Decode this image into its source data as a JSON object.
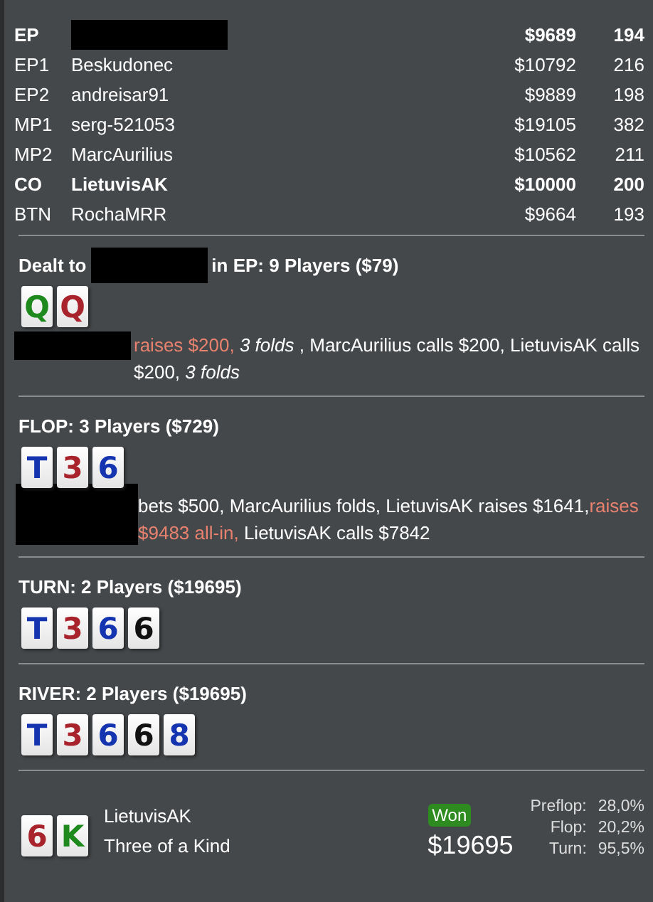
{
  "players": [
    {
      "position": "EP",
      "name_redacted": true,
      "stack": "$9689",
      "bb": "194",
      "hero": true
    },
    {
      "position": "EP1",
      "name_redacted": false,
      "name": "Beskudonec",
      "stack": "$10792",
      "bb": "216",
      "hero": false
    },
    {
      "position": "EP2",
      "name_redacted": false,
      "name": "andreisar91",
      "stack": "$9889",
      "bb": "198",
      "hero": false
    },
    {
      "position": "MP1",
      "name_redacted": false,
      "name": "serg-521053",
      "stack": "$19105",
      "bb": "382",
      "hero": false
    },
    {
      "position": "MP2",
      "name_redacted": false,
      "name": "MarcAurilius",
      "stack": "$10562",
      "bb": "211",
      "hero": false
    },
    {
      "position": "CO",
      "name_redacted": false,
      "name": "LietuvisAK",
      "stack": "$10000",
      "bb": "200",
      "hero": true
    },
    {
      "position": "BTN",
      "name_redacted": false,
      "name": "RochaMRR",
      "stack": "$9664",
      "bb": "193",
      "hero": false
    }
  ],
  "streets": [
    {
      "heading": [
        {
          "kind": "text",
          "text": "Dealt to"
        },
        {
          "kind": "redacted"
        },
        {
          "kind": "text",
          "text": "in EP: 9 Players ($79)"
        }
      ],
      "cards": [
        {
          "rank": "Q",
          "color": "#1e8a1e"
        },
        {
          "rank": "Q",
          "color": "#a8232b"
        }
      ],
      "actions": [
        {
          "kind": "redacted"
        },
        {
          "kind": "raise",
          "text": "raises $200,"
        },
        {
          "kind": "fold",
          "text": "3 folds"
        },
        {
          "kind": "plain",
          "text": ", MarcAurilius calls $200, LietuvisAK calls $200, "
        },
        {
          "kind": "fold",
          "text": "3 folds"
        }
      ]
    },
    {
      "heading": [
        {
          "kind": "text",
          "text": "FLOP: 3 Players ($729)"
        }
      ],
      "cards": [
        {
          "rank": "T",
          "color": "#1535b0"
        },
        {
          "rank": "3",
          "color": "#a8232b"
        },
        {
          "rank": "6",
          "color": "#1535b0"
        }
      ],
      "actions": [
        {
          "kind": "redacted-tall"
        },
        {
          "kind": "plain",
          "text": "bets $500, MarcAurilius folds, LietuvisAK raises $1641,"
        },
        {
          "kind": "raise",
          "text": "raises $9483 all-in,"
        },
        {
          "kind": "plain",
          "text": "LietuvisAK calls $7842"
        }
      ]
    },
    {
      "heading": [
        {
          "kind": "text",
          "text": "TURN: 2 Players ($19695)"
        }
      ],
      "cards": [
        {
          "rank": "T",
          "color": "#1535b0"
        },
        {
          "rank": "3",
          "color": "#a8232b"
        },
        {
          "rank": "6",
          "color": "#1535b0"
        },
        {
          "rank": "6",
          "color": "#111111"
        }
      ]
    },
    {
      "heading": [
        {
          "kind": "text",
          "text": "RIVER: 2 Players ($19695)"
        }
      ],
      "cards": [
        {
          "rank": "T",
          "color": "#1535b0"
        },
        {
          "rank": "3",
          "color": "#a8232b"
        },
        {
          "rank": "6",
          "color": "#1535b0"
        },
        {
          "rank": "6",
          "color": "#111111"
        },
        {
          "rank": "8",
          "color": "#1535b0"
        }
      ]
    }
  ],
  "result": {
    "cards": [
      {
        "rank": "6",
        "color": "#a8232b"
      },
      {
        "rank": "K",
        "color": "#1e8a1e"
      }
    ],
    "player": "LietuvisAK",
    "hand": "Three of a Kind",
    "badge": "Won",
    "amount": "$19695",
    "equity": [
      {
        "label": "Preflop:",
        "value": "28,0%"
      },
      {
        "label": "Flop:",
        "value": "20,2%"
      },
      {
        "label": "Turn:",
        "value": "95,5%"
      }
    ]
  }
}
